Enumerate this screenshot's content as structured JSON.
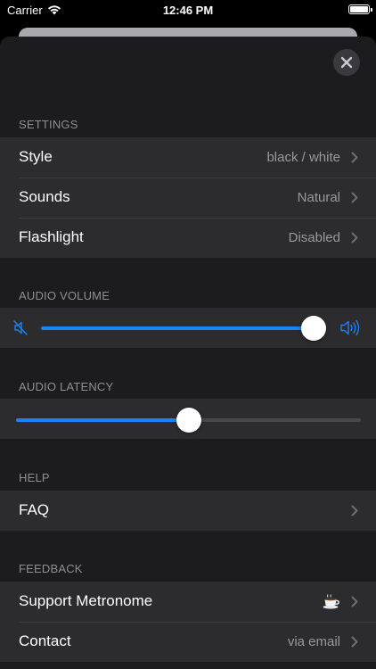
{
  "status_bar": {
    "carrier": "Carrier",
    "time": "12:46 PM"
  },
  "sections": {
    "settings": {
      "header": "SETTINGS",
      "rows": [
        {
          "label": "Style",
          "value": "black / white"
        },
        {
          "label": "Sounds",
          "value": "Natural"
        },
        {
          "label": "Flashlight",
          "value": "Disabled"
        }
      ]
    },
    "audio_volume": {
      "header": "AUDIO VOLUME",
      "level": 1.0
    },
    "audio_latency": {
      "header": "AUDIO LATENCY",
      "level": 0.5
    },
    "help": {
      "header": "HELP",
      "rows": [
        {
          "label": "FAQ",
          "value": ""
        }
      ]
    },
    "feedback": {
      "header": "FEEDBACK",
      "rows": [
        {
          "label": "Support Metronome",
          "icon": "coffee-cup-icon"
        },
        {
          "label": "Contact",
          "value": "via email"
        }
      ]
    }
  },
  "colors": {
    "accent": "#1a82f7",
    "sheet_background": "#1c1c1e",
    "row_background": "#2c2c2e",
    "secondary_text": "#98989d"
  }
}
